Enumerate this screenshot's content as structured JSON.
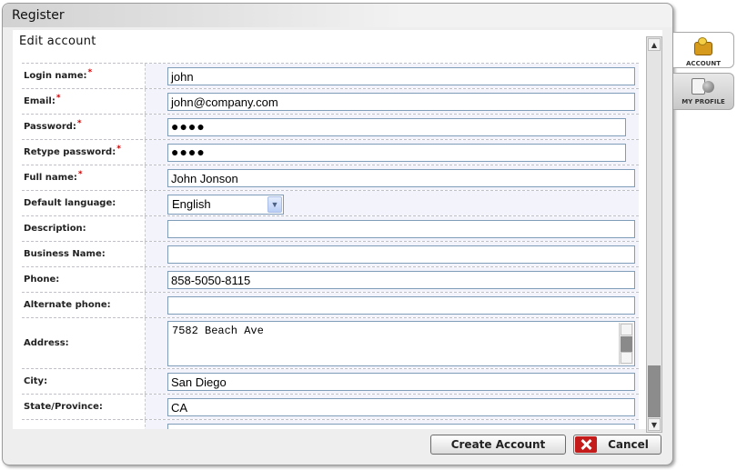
{
  "window": {
    "title": "Register"
  },
  "section": {
    "title": "Edit account"
  },
  "form": {
    "fields": [
      {
        "label": "Login name:",
        "required": "*",
        "value": "john"
      },
      {
        "label": "Email:",
        "required": "*",
        "value": "john@company.com"
      },
      {
        "label": "Password:",
        "required": "*",
        "value": "●●●●"
      },
      {
        "label": "Retype password:",
        "required": "*",
        "value": "●●●●"
      },
      {
        "label": "Full name:",
        "required": "*",
        "value": "John Jonson"
      },
      {
        "label": "Default language:",
        "value": "English"
      },
      {
        "label": "Description:",
        "value": ""
      },
      {
        "label": "Business Name:",
        "value": ""
      },
      {
        "label": "Phone:",
        "value": "858-5050-8115"
      },
      {
        "label": "Alternate phone:",
        "value": ""
      },
      {
        "label": "Address:",
        "value": "7582 Beach Ave"
      },
      {
        "label": "City:",
        "value": "San Diego"
      },
      {
        "label": "State/Province:",
        "value": "CA"
      },
      {
        "label": "",
        "value": ""
      }
    ]
  },
  "buttons": {
    "create": "Create Account",
    "cancel": "Cancel"
  },
  "tabs": {
    "account": "ACCOUNT",
    "profile": "MY PROFILE"
  },
  "colors": {
    "required": "#cc0000",
    "cancel_icon": "#c41a1a",
    "field_band": "#f3f3fb",
    "input_border": "#7f9db9"
  },
  "icons": {
    "account": "account-icon",
    "profile": "profile-icon",
    "cancel": "close-icon"
  }
}
